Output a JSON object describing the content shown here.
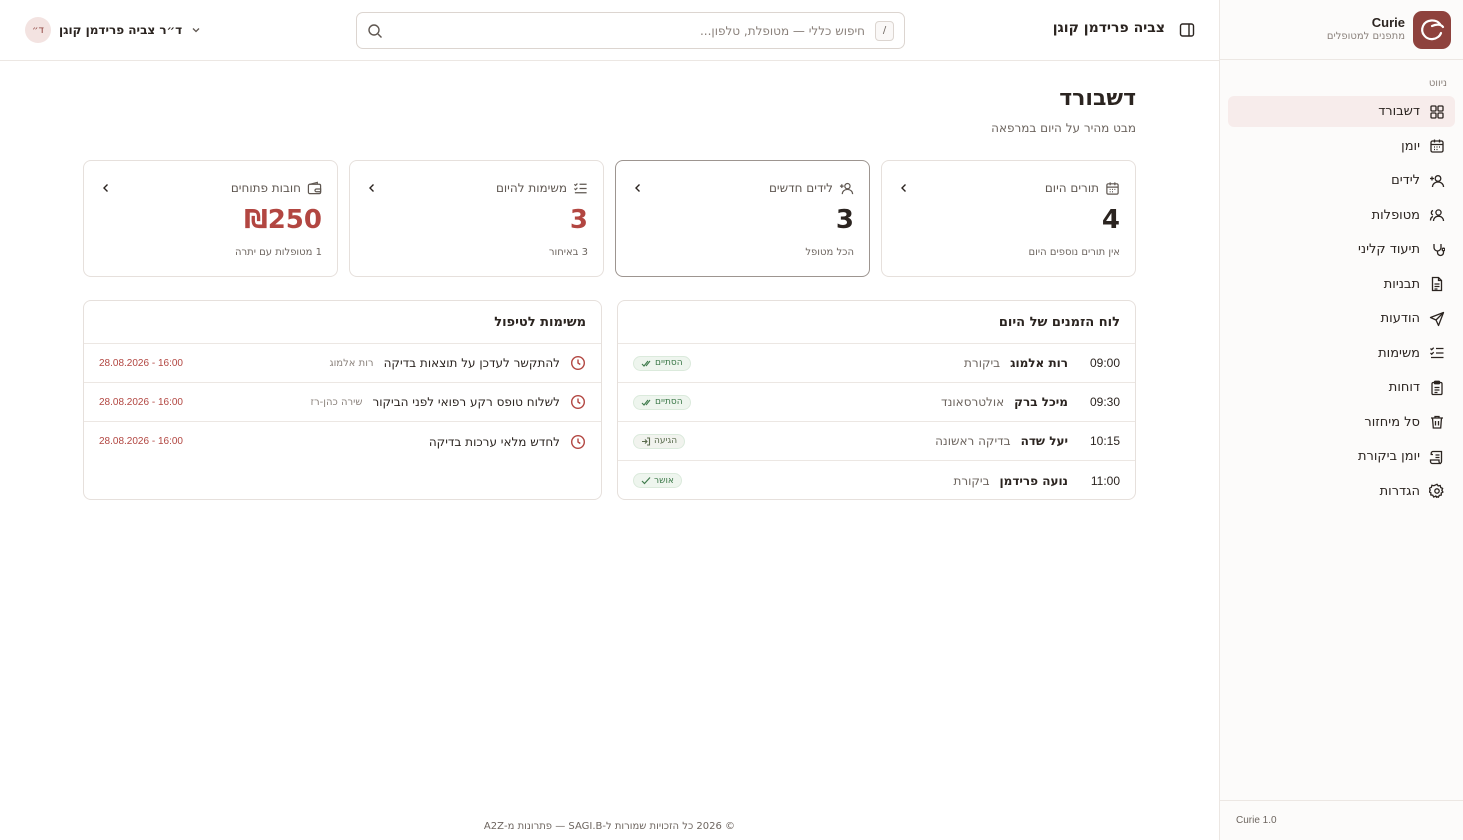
{
  "brand": {
    "name": "Curie",
    "subtitle": "מתפנים למטופלים",
    "version": "Curie 1.0"
  },
  "sidebar": {
    "section_label": "ניווט",
    "items": [
      {
        "label": "דשבורד",
        "icon": "dashboard-icon",
        "active": true
      },
      {
        "label": "יומן",
        "icon": "calendar-icon"
      },
      {
        "label": "לידים",
        "icon": "user-plus-icon"
      },
      {
        "label": "מטופלות",
        "icon": "users-icon"
      },
      {
        "label": "תיעוד קליני",
        "icon": "stethoscope-icon"
      },
      {
        "label": "תבניות",
        "icon": "file-text-icon"
      },
      {
        "label": "הודעות",
        "icon": "send-icon"
      },
      {
        "label": "משימות",
        "icon": "list-checks-icon"
      },
      {
        "label": "דוחות",
        "icon": "clipboard-icon"
      },
      {
        "label": "סל מיחזור",
        "icon": "trash-icon"
      },
      {
        "label": "יומן ביקורת",
        "icon": "scroll-icon"
      },
      {
        "label": "הגדרות",
        "icon": "gear-icon"
      }
    ]
  },
  "topbar": {
    "clinic_name": "צביה פרידמן קוגן",
    "search_placeholder": "חיפוש כללי — מטופלת, טלפון...",
    "search_shortcut": "/",
    "user_initials": "ד״",
    "user_name": "ד״ר צביה פרידמן קוגן"
  },
  "page": {
    "title": "דשבורד",
    "subtitle": "מבט מהיר על היום במרפאה"
  },
  "stats": [
    {
      "label": "תורים היום",
      "value": "4",
      "note": "אין תורים נוספים היום",
      "icon": "calendar-icon"
    },
    {
      "label": "לידים חדשים",
      "value": "3",
      "note": "הכל מטופל",
      "icon": "user-plus-icon"
    },
    {
      "label": "משימות להיום",
      "value": "3",
      "note": "3 באיחור",
      "icon": "list-checks-icon"
    },
    {
      "label": "חובות פתוחים",
      "value": "₪250",
      "note": "1 מטופלות עם יתרה",
      "icon": "wallet-icon"
    }
  ],
  "schedule": {
    "title": "לוח הזמנים של היום",
    "rows": [
      {
        "time": "09:00",
        "name": "רות אלמוג",
        "type": "ביקורת",
        "status": "הסתיים",
        "status_icon": "double-check-icon"
      },
      {
        "time": "09:30",
        "name": "מיכל ברק",
        "type": "אולטרסאונד",
        "status": "הסתיים",
        "status_icon": "double-check-icon"
      },
      {
        "time": "10:15",
        "name": "יעל שדה",
        "type": "בדיקה ראשונה",
        "status": "הגיעה",
        "status_icon": "login-icon"
      },
      {
        "time": "11:00",
        "name": "נועה פרידמן",
        "type": "ביקורת",
        "status": "אושר",
        "status_icon": "check-icon"
      }
    ]
  },
  "tasks": {
    "title": "משימות לטיפול",
    "rows": [
      {
        "title": "להתקשר לעדכן על תוצאות בדיקה",
        "patient": "רות אלמוג",
        "due": "16:00 - 28.08.2026"
      },
      {
        "title": "לשלוח טופס רקע רפואי לפני הביקור",
        "patient": "שירה כהן-רז",
        "due": "16:00 - 28.08.2026"
      },
      {
        "title": "לחדש מלאי ערכות בדיקה",
        "patient": "",
        "due": "16:00 - 28.08.2026"
      }
    ]
  },
  "footer": {
    "copyright": "© 2026 כל הזכויות שמורות ל-SAGI.B — פתרונות מ-A2Z"
  },
  "colors": {
    "accent": "#8e423d",
    "danger": "#b24641",
    "success": "#3e7a4b",
    "active_bg": "#f7eceb"
  }
}
